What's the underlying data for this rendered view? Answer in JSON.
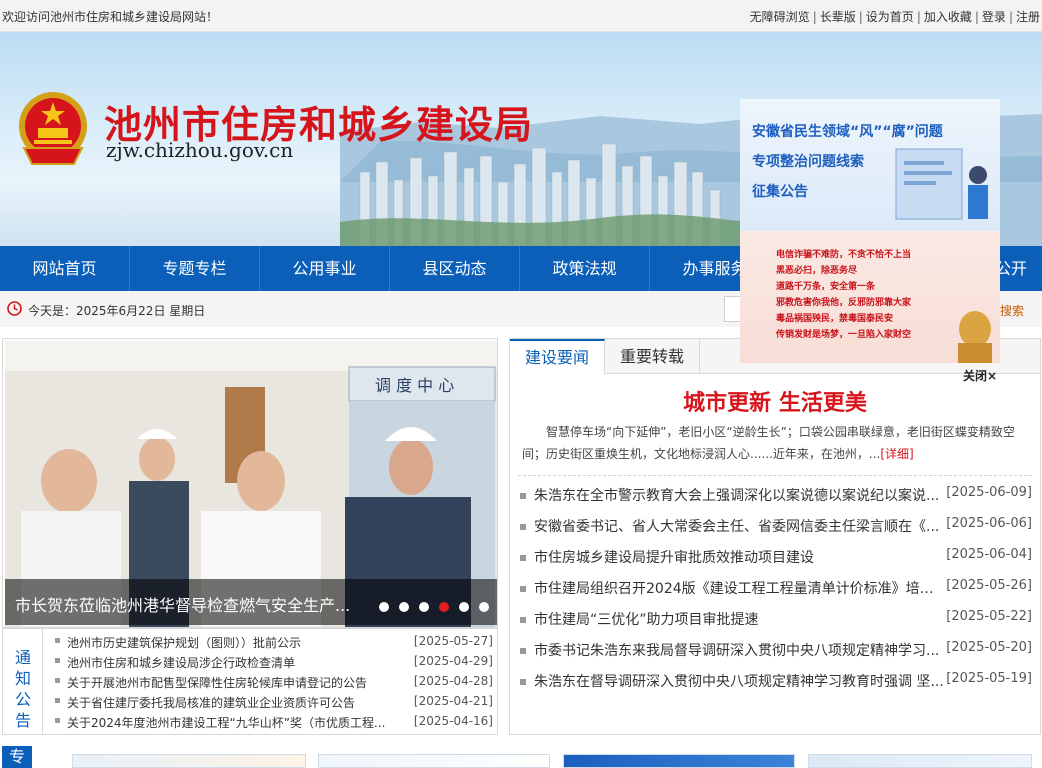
{
  "topbar": {
    "welcome": "欢迎访问池州市住房和城乡建设局网站！",
    "links": [
      "无障碍浏览",
      "长辈版",
      "设为首页",
      "加入收藏",
      "登录",
      "注册"
    ]
  },
  "banner": {
    "title": "池州市住房和城乡建设局",
    "domain": "zjw.chizhou.gov.cn"
  },
  "nav": {
    "items": [
      "网站首页",
      "专题专栏",
      "公用事业",
      "县区动态",
      "政策法规",
      "办事服务",
      "公开"
    ]
  },
  "dateline": {
    "today": "今天是：2025年6月22日 星期日",
    "search_label": "搜索"
  },
  "slider": {
    "caption": "市长贺东莅临池州港华督导检查燃气安全生产...",
    "dot_count": 6,
    "active_dot": 4
  },
  "notices": {
    "label": "通知公告",
    "items": [
      {
        "title": "池州市历史建筑保护规划（图则））批前公示",
        "date": "[2025-05-27]"
      },
      {
        "title": "池州市住房和城乡建设局涉企行政检查清单",
        "date": "[2025-04-29]"
      },
      {
        "title": "关于开展池州市配售型保障性住房轮候库申请登记的公告",
        "date": "[2025-04-28]"
      },
      {
        "title": "关于省住建厅委托我局核准的建筑业企业资质许可公告",
        "date": "[2025-04-21]"
      },
      {
        "title": "关于2024年度池州市建设工程“九华山杯”奖（市优质工程...",
        "date": "[2025-04-16]"
      }
    ]
  },
  "news": {
    "tabs": [
      "建设要闻",
      "重要转载"
    ],
    "headline": "城市更新 生活更美",
    "summary": "智慧停车场“向下延伸”，老旧小区“逆龄生长”；口袋公园串联绿意，老旧街区蝶变精致空间；历史街区重焕生机，文化地标浸润人心......近年来，在池州，...",
    "more": "[详细]",
    "items": [
      {
        "title": "朱浩东在全市警示教育大会上强调深化以案说德以案说纪以案说...",
        "date": "[2025-06-09]"
      },
      {
        "title": "安徽省委书记、省人大常委会主任、省委网信委主任梁言顺在《...",
        "date": "[2025-06-06]"
      },
      {
        "title": "市住房城乡建设局提升审批质效推动项目建设",
        "date": "[2025-06-04]"
      },
      {
        "title": "市住建局组织召开2024版《建设工程工程量清单计价标准》培训...",
        "date": "[2025-05-26]"
      },
      {
        "title": "市住建局“三优化”助力项目审批提速",
        "date": "[2025-05-22]"
      },
      {
        "title": "市委书记朱浩东来我局督导调研深入贯彻中央八项规定精神学习...",
        "date": "[2025-05-20]"
      },
      {
        "title": "朱浩东在督导调研深入贯彻中央八项规定精神学习教育时强调 坚...",
        "date": "[2025-05-19]"
      }
    ]
  },
  "bottom": {
    "special_label": "专"
  },
  "float_ad": {
    "ad1_lines": [
      "安徽省民生领域“风”“腐”问题",
      "专项整治问题线索",
      "征集公告"
    ],
    "ad2_lines": [
      "电信诈骗不难防，不贪不恰不上当",
      "黑恶必扫，除恶务尽",
      "道路千万条，安全第一条",
      "邪教危害你我他，反邪防邪靠大家",
      "毒品祸国殃民，禁毒国泰民安",
      "传销发财是场梦，一旦陷入家财空"
    ],
    "close_label": "关闭×"
  }
}
